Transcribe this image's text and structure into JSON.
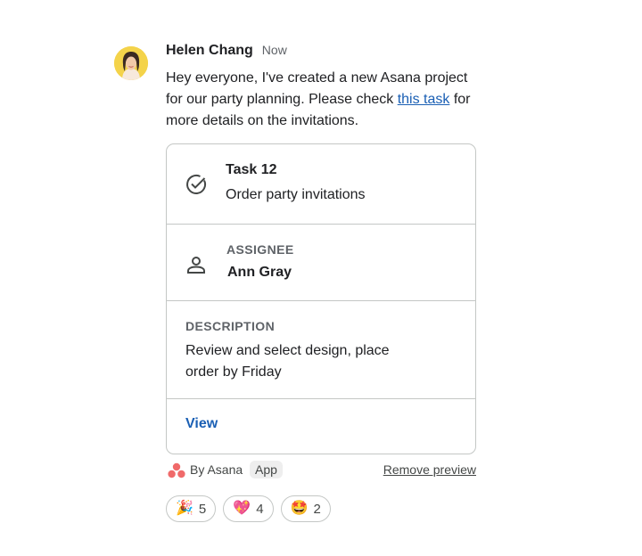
{
  "message": {
    "sender": "Helen Chang",
    "timestamp": "Now",
    "text_before_link": "Hey everyone, I've created a new Asana project for our party planning.  Please check ",
    "link_text": "this task",
    "text_after_link": " for more details on the invitations."
  },
  "card": {
    "task_title": "Task 12",
    "task_name": "Order party invitations",
    "assignee_label": "ASSIGNEE",
    "assignee_name": "Ann Gray",
    "description_label": "DESCRIPTION",
    "description_text": "Review and select design, place order by Friday",
    "view_label": "View",
    "icons": {
      "task": "check-circle-icon",
      "assignee": "person-icon"
    }
  },
  "footer": {
    "by_text": "By Asana",
    "app_chip": "App",
    "remove_preview": "Remove preview",
    "logo": "asana-logo",
    "asana_color": "#f06a6a"
  },
  "reactions": [
    {
      "emoji": "🎉",
      "count": "5"
    },
    {
      "emoji": "💖",
      "count": "4"
    },
    {
      "emoji": "🤩",
      "count": "2"
    }
  ],
  "colors": {
    "link": "#1a5fb4",
    "border": "#c4c7c5",
    "avatar_bg": "#f4d34a"
  }
}
